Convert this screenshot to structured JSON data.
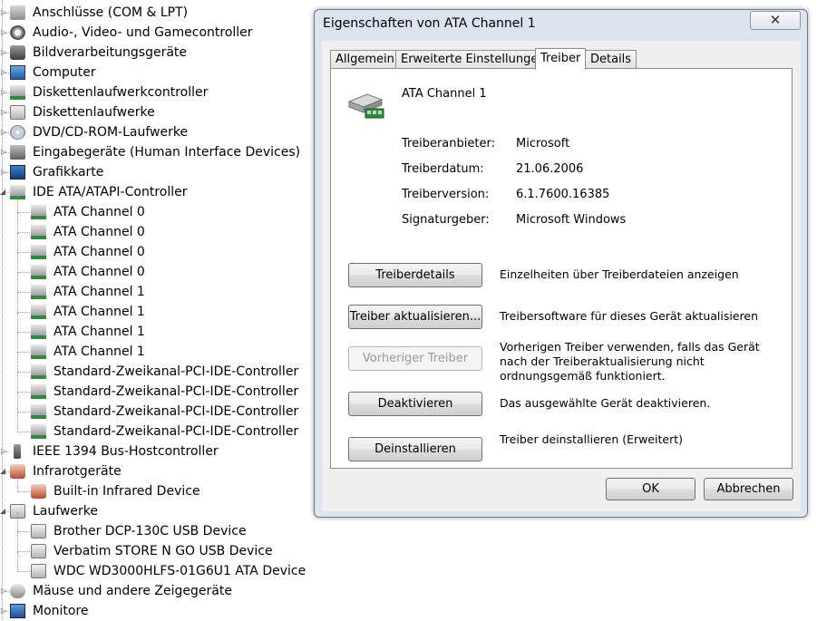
{
  "tree": {
    "items": [
      {
        "label": "Anschlüsse (COM & LPT)",
        "icon": "port-icon",
        "level": 0
      },
      {
        "label": "Audio-, Video- und Gamecontroller",
        "icon": "audio-icon",
        "level": 0
      },
      {
        "label": "Bildverarbeitungsgeräte",
        "icon": "camera-icon",
        "level": 0
      },
      {
        "label": "Computer",
        "icon": "computer-icon",
        "level": 0
      },
      {
        "label": "Diskettenlaufwerkcontroller",
        "icon": "controller-icon",
        "level": 0
      },
      {
        "label": "Diskettenlaufwerke",
        "icon": "floppy-drive-icon",
        "level": 0
      },
      {
        "label": "DVD/CD-ROM-Laufwerke",
        "icon": "disc-drive-icon",
        "level": 0
      },
      {
        "label": "Eingabegeräte (Human Interface Devices)",
        "icon": "keyboard-icon",
        "level": 0
      },
      {
        "label": "Grafikkarte",
        "icon": "display-adapter-icon",
        "level": 0
      },
      {
        "label": "IDE ATA/ATAPI-Controller",
        "icon": "ide-controller-icon",
        "level": 0,
        "expanded": true
      },
      {
        "label": "ATA Channel 0",
        "icon": "ide-channel-icon",
        "level": 1
      },
      {
        "label": "ATA Channel 0",
        "icon": "ide-channel-icon",
        "level": 1
      },
      {
        "label": "ATA Channel 0",
        "icon": "ide-channel-icon",
        "level": 1
      },
      {
        "label": "ATA Channel 0",
        "icon": "ide-channel-icon",
        "level": 1
      },
      {
        "label": "ATA Channel 1",
        "icon": "ide-channel-icon",
        "level": 1
      },
      {
        "label": "ATA Channel 1",
        "icon": "ide-channel-icon",
        "level": 1
      },
      {
        "label": "ATA Channel 1",
        "icon": "ide-channel-icon",
        "level": 1
      },
      {
        "label": "ATA Channel 1",
        "icon": "ide-channel-icon",
        "level": 1
      },
      {
        "label": "Standard-Zweikanal-PCI-IDE-Controller",
        "icon": "ide-channel-icon",
        "level": 1
      },
      {
        "label": "Standard-Zweikanal-PCI-IDE-Controller",
        "icon": "ide-channel-icon",
        "level": 1
      },
      {
        "label": "Standard-Zweikanal-PCI-IDE-Controller",
        "icon": "ide-channel-icon",
        "level": 1
      },
      {
        "label": "Standard-Zweikanal-PCI-IDE-Controller",
        "icon": "ide-channel-icon",
        "level": 1
      },
      {
        "label": "IEEE 1394 Bus-Hostcontroller",
        "icon": "firewire-icon",
        "level": 0
      },
      {
        "label": "Infrarotgeräte",
        "icon": "infrared-icon",
        "level": 0,
        "expanded": true
      },
      {
        "label": "Built-in Infrared Device",
        "icon": "infrared-device-icon",
        "level": 1
      },
      {
        "label": "Laufwerke",
        "icon": "disk-drives-icon",
        "level": 0,
        "expanded": true
      },
      {
        "label": "Brother DCP-130C USB Device",
        "icon": "disk-drive-icon",
        "level": 1
      },
      {
        "label": "Verbatim STORE N GO USB Device",
        "icon": "disk-drive-icon",
        "level": 1
      },
      {
        "label": "WDC WD3000HLFS-01G6U1 ATA Device",
        "icon": "disk-drive-icon",
        "level": 1
      },
      {
        "label": "Mäuse und andere Zeigegeräte",
        "icon": "mouse-icon",
        "level": 0
      },
      {
        "label": "Monitore",
        "icon": "monitor-icon",
        "level": 0
      }
    ]
  },
  "dialog": {
    "title": "Eigenschaften von ATA Channel 1",
    "close_glyph": "✕",
    "tabs": [
      {
        "label": "Allgemein",
        "active": false
      },
      {
        "label": "Erweiterte Einstellungen",
        "active": false
      },
      {
        "label": "Treiber",
        "active": true
      },
      {
        "label": "Details",
        "active": false
      }
    ],
    "device_name": "ATA Channel 1",
    "device_icon": "ide-channel-icon",
    "fields": [
      {
        "label": "Treiberanbieter:",
        "value": "Microsoft"
      },
      {
        "label": "Treiberdatum:",
        "value": "21.06.2006"
      },
      {
        "label": "Treiberversion:",
        "value": "6.1.7600.16385"
      },
      {
        "label": "Signaturgeber:",
        "value": "Microsoft Windows"
      }
    ],
    "actions": [
      {
        "button": "Treiberdetails",
        "description": "Einzelheiten über Treiberdateien anzeigen",
        "enabled": true
      },
      {
        "button": "Treiber aktualisieren...",
        "description": "Treibersoftware für dieses Gerät aktualisieren",
        "enabled": true
      },
      {
        "button": "Vorheriger Treiber",
        "description": "Vorherigen Treiber verwenden, falls das Gerät nach der Treiberaktualisierung nicht ordnungsgemäß funktioniert.",
        "enabled": false
      },
      {
        "button": "Deaktivieren",
        "description": "Das ausgewählte Gerät deaktivieren.",
        "enabled": true
      },
      {
        "button": "Deinstallieren",
        "description": "Treiber deinstallieren (Erweitert)",
        "enabled": true
      }
    ],
    "ok_label": "OK",
    "cancel_label": "Abbrechen"
  }
}
